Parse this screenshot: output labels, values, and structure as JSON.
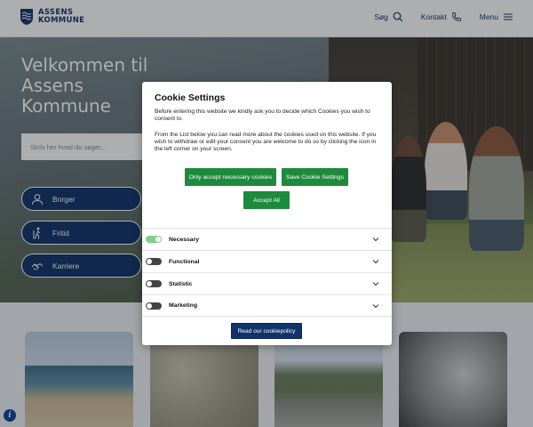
{
  "header": {
    "logo_line1": "ASSENS",
    "logo_line2": "KOMMUNE",
    "nav": {
      "search_label": "Søg",
      "contact_label": "Kontakt",
      "menu_label": "Menu"
    }
  },
  "hero": {
    "title_line1": "Velkommen til",
    "title_line2": "Assens",
    "title_line3": "Kommune",
    "search_placeholder": "Skriv her hvad du søger...",
    "categories": [
      {
        "label": "Borger",
        "icon": "person-icon"
      },
      {
        "label": "Fritid",
        "icon": "hiker-icon"
      },
      {
        "label": "Karriere",
        "icon": "handshake-icon"
      }
    ]
  },
  "cookie_modal": {
    "title": "Cookie Settings",
    "intro": "Before entering this website we kindly ask you to decide which Cookies you wish to consent to.",
    "details": "From the List below you can read more about the cookies used on this website. If you wish to withdraw or edit your consent you are welcome to do so by clicking the icon in the left corner on your screen.",
    "buttons": {
      "necessary_only": "Only accept necessary cookies",
      "save_settings": "Save Cookie Settings",
      "accept_all": "Accept All",
      "read_policy": "Read our cookiepolicy"
    },
    "categories": [
      {
        "label": "Necessary",
        "enabled": true
      },
      {
        "label": "Functional",
        "enabled": false
      },
      {
        "label": "Statistic",
        "enabled": false
      },
      {
        "label": "Marketing",
        "enabled": false
      }
    ]
  },
  "colors": {
    "brand_navy": "#10336b",
    "accept_green": "#1e8a3c",
    "toggle_on": "#7fcf8c"
  },
  "info_button_glyph": "i"
}
